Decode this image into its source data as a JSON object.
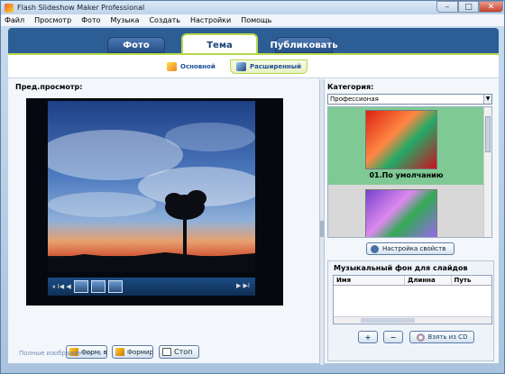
{
  "window": {
    "title": "Flash Slideshow Maker Professional",
    "min": "–",
    "max": "□",
    "close": "✕"
  },
  "menu": [
    "Файл",
    "Просмотр",
    "Фото",
    "Музыка",
    "Создать",
    "Настройки",
    "Помощь"
  ],
  "tabs": {
    "photo": "Фото",
    "theme": "Тема",
    "publish": "Публиковать"
  },
  "subtabs": {
    "basic": "Основной",
    "advanced": "Расширенный"
  },
  "preview": {
    "label": "Пред.просмотр:",
    "controls_left": "⏸ I◀ ◀",
    "controls_right": "▶ ▶I"
  },
  "buttons": {
    "form_all": "Форм. все",
    "form": "Формир.",
    "stop": "Стоп"
  },
  "category": {
    "label": "Категория:",
    "value": "Профессионая",
    "arrow": "▼"
  },
  "themes": [
    {
      "label": "01.По умолчанию"
    }
  ],
  "props_button": "Настройка свойств",
  "music": {
    "label": "Музыкальный фон для слайдов",
    "columns": [
      "Имя",
      "Длинна",
      "Путь"
    ],
    "add": "+",
    "remove": "−",
    "from_cd": "Взять из CD"
  },
  "status": "Полные изображения : 3"
}
